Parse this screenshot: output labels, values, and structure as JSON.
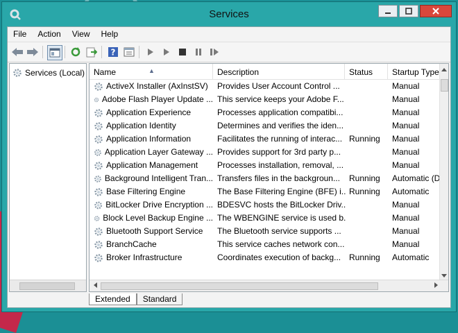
{
  "window": {
    "title": "Services"
  },
  "menu": [
    "File",
    "Action",
    "View",
    "Help"
  ],
  "toolbar_icons": [
    "back-icon",
    "forward-icon",
    "show-hide-console-tree-icon",
    "refresh-icon",
    "export-list-icon",
    "help-icon",
    "properties-icon",
    "start-service-icon",
    "start-service-alt-icon",
    "stop-service-icon",
    "pause-service-icon",
    "restart-service-icon"
  ],
  "tree": {
    "root_label": "Services (Local)"
  },
  "columns": [
    "Name",
    "Description",
    "Status",
    "Startup Type"
  ],
  "services": [
    {
      "name": "ActiveX Installer (AxInstSV)",
      "description": "Provides User Account Control ...",
      "status": "",
      "startup": "Manual"
    },
    {
      "name": "Adobe Flash Player Update ...",
      "description": "This service keeps your Adobe F...",
      "status": "",
      "startup": "Manual"
    },
    {
      "name": "Application Experience",
      "description": "Processes application compatibi...",
      "status": "",
      "startup": "Manual"
    },
    {
      "name": "Application Identity",
      "description": "Determines and verifies the iden...",
      "status": "",
      "startup": "Manual"
    },
    {
      "name": "Application Information",
      "description": "Facilitates the running of interac...",
      "status": "Running",
      "startup": "Manual"
    },
    {
      "name": "Application Layer Gateway ...",
      "description": "Provides support for 3rd party p...",
      "status": "",
      "startup": "Manual"
    },
    {
      "name": "Application Management",
      "description": "Processes installation, removal, ...",
      "status": "",
      "startup": "Manual"
    },
    {
      "name": "Background Intelligent Tran...",
      "description": "Transfers files in the backgroun...",
      "status": "Running",
      "startup": "Automatic (D"
    },
    {
      "name": "Base Filtering Engine",
      "description": "The Base Filtering Engine (BFE) i...",
      "status": "Running",
      "startup": "Automatic"
    },
    {
      "name": "BitLocker Drive Encryption ...",
      "description": "BDESVC hosts the BitLocker Driv...",
      "status": "",
      "startup": "Manual"
    },
    {
      "name": "Block Level Backup Engine ...",
      "description": "The WBENGINE service is used b...",
      "status": "",
      "startup": "Manual"
    },
    {
      "name": "Bluetooth Support Service",
      "description": "The Bluetooth service supports ...",
      "status": "",
      "startup": "Manual"
    },
    {
      "name": "BranchCache",
      "description": "This service caches network con...",
      "status": "",
      "startup": "Manual"
    },
    {
      "name": "Broker Infrastructure",
      "description": "Coordinates execution of backg...",
      "status": "Running",
      "startup": "Automatic"
    }
  ],
  "tabs": [
    "Extended",
    "Standard"
  ],
  "active_tab": "Extended",
  "colors": {
    "desktop": "#1b8f95",
    "window_frame": "#29a7a9",
    "close_button": "#d9473b"
  }
}
